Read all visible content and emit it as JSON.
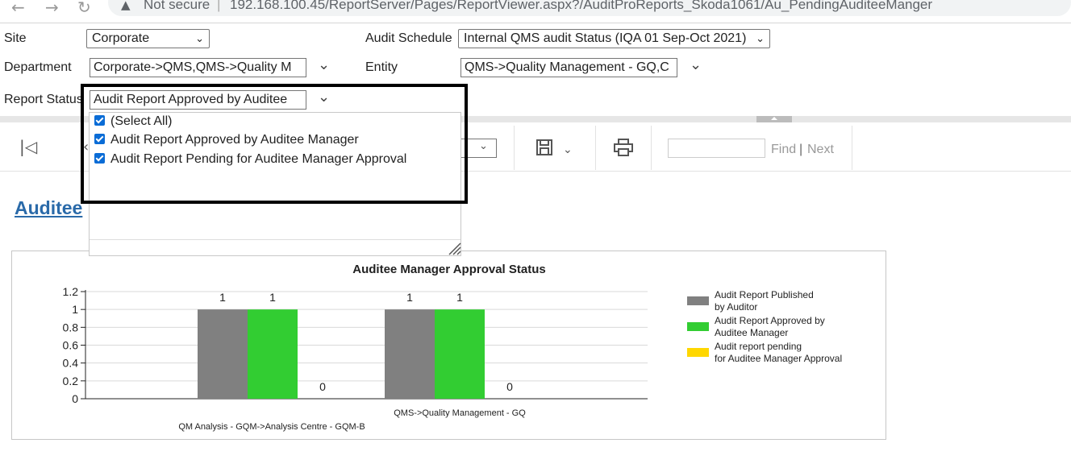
{
  "browser": {
    "back_icon": "←",
    "forward_icon": "→",
    "reload_icon": "↻",
    "security_icon": "▲",
    "security_text": "Not secure",
    "separator": "|",
    "url": "192.168.100.45/ReportServer/Pages/ReportViewer.aspx?/AuditProReports_Skoda1061/Au_PendingAuditeeManger"
  },
  "params": {
    "site_label": "Site",
    "site_value": "Corporate",
    "audit_schedule_label": "Audit Schedule",
    "audit_schedule_value": "Internal QMS audit Status (IQA 01 Sep-Oct 2021)",
    "department_label": "Department",
    "department_value": "Corporate->QMS,QMS->Quality M",
    "entity_label": "Entity",
    "entity_value": "QMS->Quality Management - GQ,C",
    "report_status_label": "Report Status",
    "report_status_value": "Audit Report Approved by Auditee"
  },
  "dropdown": {
    "options": [
      {
        "label": "(Select All)",
        "checked": true
      },
      {
        "label": "Audit Report Approved by Auditee Manager",
        "checked": true
      },
      {
        "label": "Audit Report Pending for Auditee Manager Approval",
        "checked": true
      }
    ]
  },
  "toolbar": {
    "find_label": "Find",
    "find_sep": "|",
    "next_label": "Next",
    "first_page_icon": "first-page-icon",
    "save_icon": "save-icon",
    "print_icon": "print-icon"
  },
  "report": {
    "heading": "Auditee"
  },
  "chart_data": {
    "type": "bar",
    "title": "Auditee Manager Approval Status",
    "categories": [
      "QM Analysis - GQM->Analysis Centre - GQM-B",
      "QMS->Quality Management - GQ"
    ],
    "series": [
      {
        "name": "Audit Report Published by Auditor",
        "color": "#808080",
        "values": [
          1,
          1
        ]
      },
      {
        "name": "Audit Report Approved by Auditee Manager",
        "color": "#32cd32",
        "values": [
          1,
          1
        ]
      },
      {
        "name": "Audit report pending for Auditee Manager Approval",
        "color": "#ffd700",
        "values": [
          0,
          0
        ]
      }
    ],
    "ylim": [
      0,
      1.2
    ],
    "yticks": [
      "0",
      "0.2",
      "0.4",
      "0.6",
      "0.8",
      "1",
      "1.2"
    ],
    "ytick_values": [
      0,
      0.2,
      0.4,
      0.6,
      0.8,
      1,
      1.2
    ],
    "grid": true,
    "legend_position": "right",
    "xlabel": "",
    "ylabel": ""
  }
}
